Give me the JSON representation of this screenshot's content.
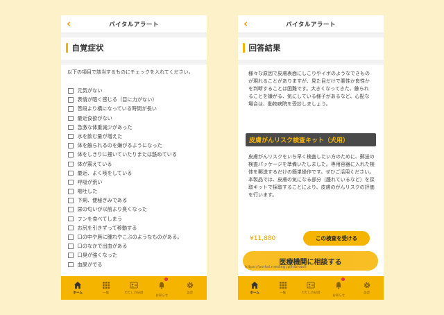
{
  "app_title": "バイタルアラート",
  "left": {
    "section_title": "自覚症状",
    "intro": "以下の項目で該当するものにチェックを入れてください。",
    "symptoms": [
      "元気がない",
      "表情が暗く感じる（目に力がない）",
      "普段より横になっている時間が長い",
      "最近食欲がない",
      "急激な体重減少があった",
      "水を飲む量が増えた",
      "体を触られるのを嫌がるようになった",
      "体をしきりに掻いていたりまたは舐めている",
      "体が震えている",
      "最近、よく咳をしている",
      "呼吸が荒い",
      "嘔吐した",
      "下痢、便秘ぎみである",
      "尿の匂いが以前より臭くなった",
      "フンを食べてしまう",
      "お尻を引きずって移動する",
      "口の中や唇に腫れやこぶのようなものがある。",
      "口のなかで出血がある",
      "口臭が強くなった",
      "血尿がでる"
    ]
  },
  "right": {
    "section_title": "回答結果",
    "results_text": "様々な原因で皮膚表面にしこりやイボのようなできものが現れることがありますが、見た目だけで悪性か良性かを判断することは困難です。大きくなってきた、触られることを嫌がる、気にしている様子があるなど、心配な場合は、動物病院を受診しましょう。",
    "product_name": "皮膚がんリスク検査キット（犬用）",
    "product_text_1": "皮膚がんリスクをいち早く検査したい方のために、郵送の検査パッケージを準備いたしました。専用容器に入れた検体を郵送するだけの簡単操作です。ぜひご活用ください。",
    "product_text_2": "本製品では、皮膚の気になる部分（腫れているなど）を採取キットで採取することにより、皮膚のがんリスクの評価を行います。",
    "price": "¥11,880",
    "test_button": "この検査を受ける",
    "consult_button": "医療機関に相談する",
    "url": "https://portal.medleg.jp/hlbnas0"
  },
  "nav": [
    {
      "label": "ホーム",
      "icon": "home-icon"
    },
    {
      "label": "一覧",
      "icon": "grid-icon"
    },
    {
      "label": "わたしの記録",
      "icon": "profile-card-icon"
    },
    {
      "label": "お知らせ",
      "icon": "bell-icon"
    },
    {
      "label": "設定",
      "icon": "gear-icon"
    }
  ],
  "colors": {
    "accent": "#f5b400",
    "background": "#fdf1c9",
    "banner": "#4a4a4a",
    "price": "#e6a000"
  }
}
